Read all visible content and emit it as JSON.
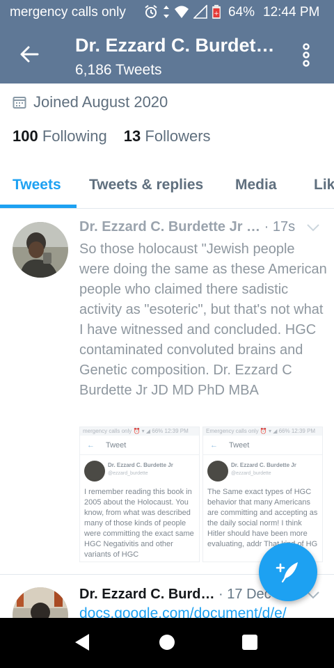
{
  "status_bar": {
    "carrier": "mergency calls only",
    "battery": "64%",
    "time": "12:44 PM",
    "icons": [
      "alarm-icon",
      "data-arrows-icon",
      "wifi-icon",
      "signal-icon",
      "battery-icon"
    ]
  },
  "header": {
    "title": "Dr. Ezzard C. Burdet…",
    "subtitle": "6,186 Tweets",
    "icons": [
      "back-arrow-icon",
      "more-vertical-icon"
    ]
  },
  "profile": {
    "joined": "Joined August 2020",
    "following_count": "100",
    "following_label": "Following",
    "followers_count": "13",
    "followers_label": "Followers"
  },
  "tabs": [
    {
      "label": "Tweets",
      "active": true
    },
    {
      "label": "Tweets & replies",
      "active": false
    },
    {
      "label": "Media",
      "active": false
    },
    {
      "label": "Lik",
      "active": false
    }
  ],
  "tweet1": {
    "name": "Dr. Ezzard C. Burdette Jr …",
    "time": "· 17s",
    "text": "So those holocaust \"Jewish people were doing the same as these American people who claimed there sadistic activity as \"esoteric\", but that's not what I have witnessed and concluded. HGC contaminated convoluted brains and Genetic composition. Dr. Ezzard C Burdette Jr JD MD PhD MBA",
    "media": [
      {
        "status": "mergency calls only   ⏰ ▾ ◢ 66% 12:39 PM",
        "header": "Tweet",
        "name": "Dr. Ezzard C. Burdette Jr",
        "handle": "@ezzard_burdette",
        "text": "I remember reading this book in 2005 about the Holocaust. You know, from what was described many of those kinds of people were committing the exact same HGC Negativitis and other variants of HGC"
      },
      {
        "status": "Emergency calls only  ⏰ ▾ ◢ 66% 12:39 PM",
        "header": "Tweet",
        "name": "Dr. Ezzard C. Burdette Jr",
        "handle": "@ezzard_burdette",
        "text": "The Same exact types of HGC behavior that many Americans are committing and accepting as the daily social norm! I think Hitler should have been more evaluating, addr That kind of HG"
      }
    ]
  },
  "tweet2": {
    "name": "Dr. Ezzard C. Burd…",
    "time": "· 17 Dec",
    "link": "docs.google.com/document/d/e/"
  },
  "colors": {
    "header_bg": "#5f7896",
    "accent": "#1da1f2",
    "nav_bg": "#000000"
  }
}
